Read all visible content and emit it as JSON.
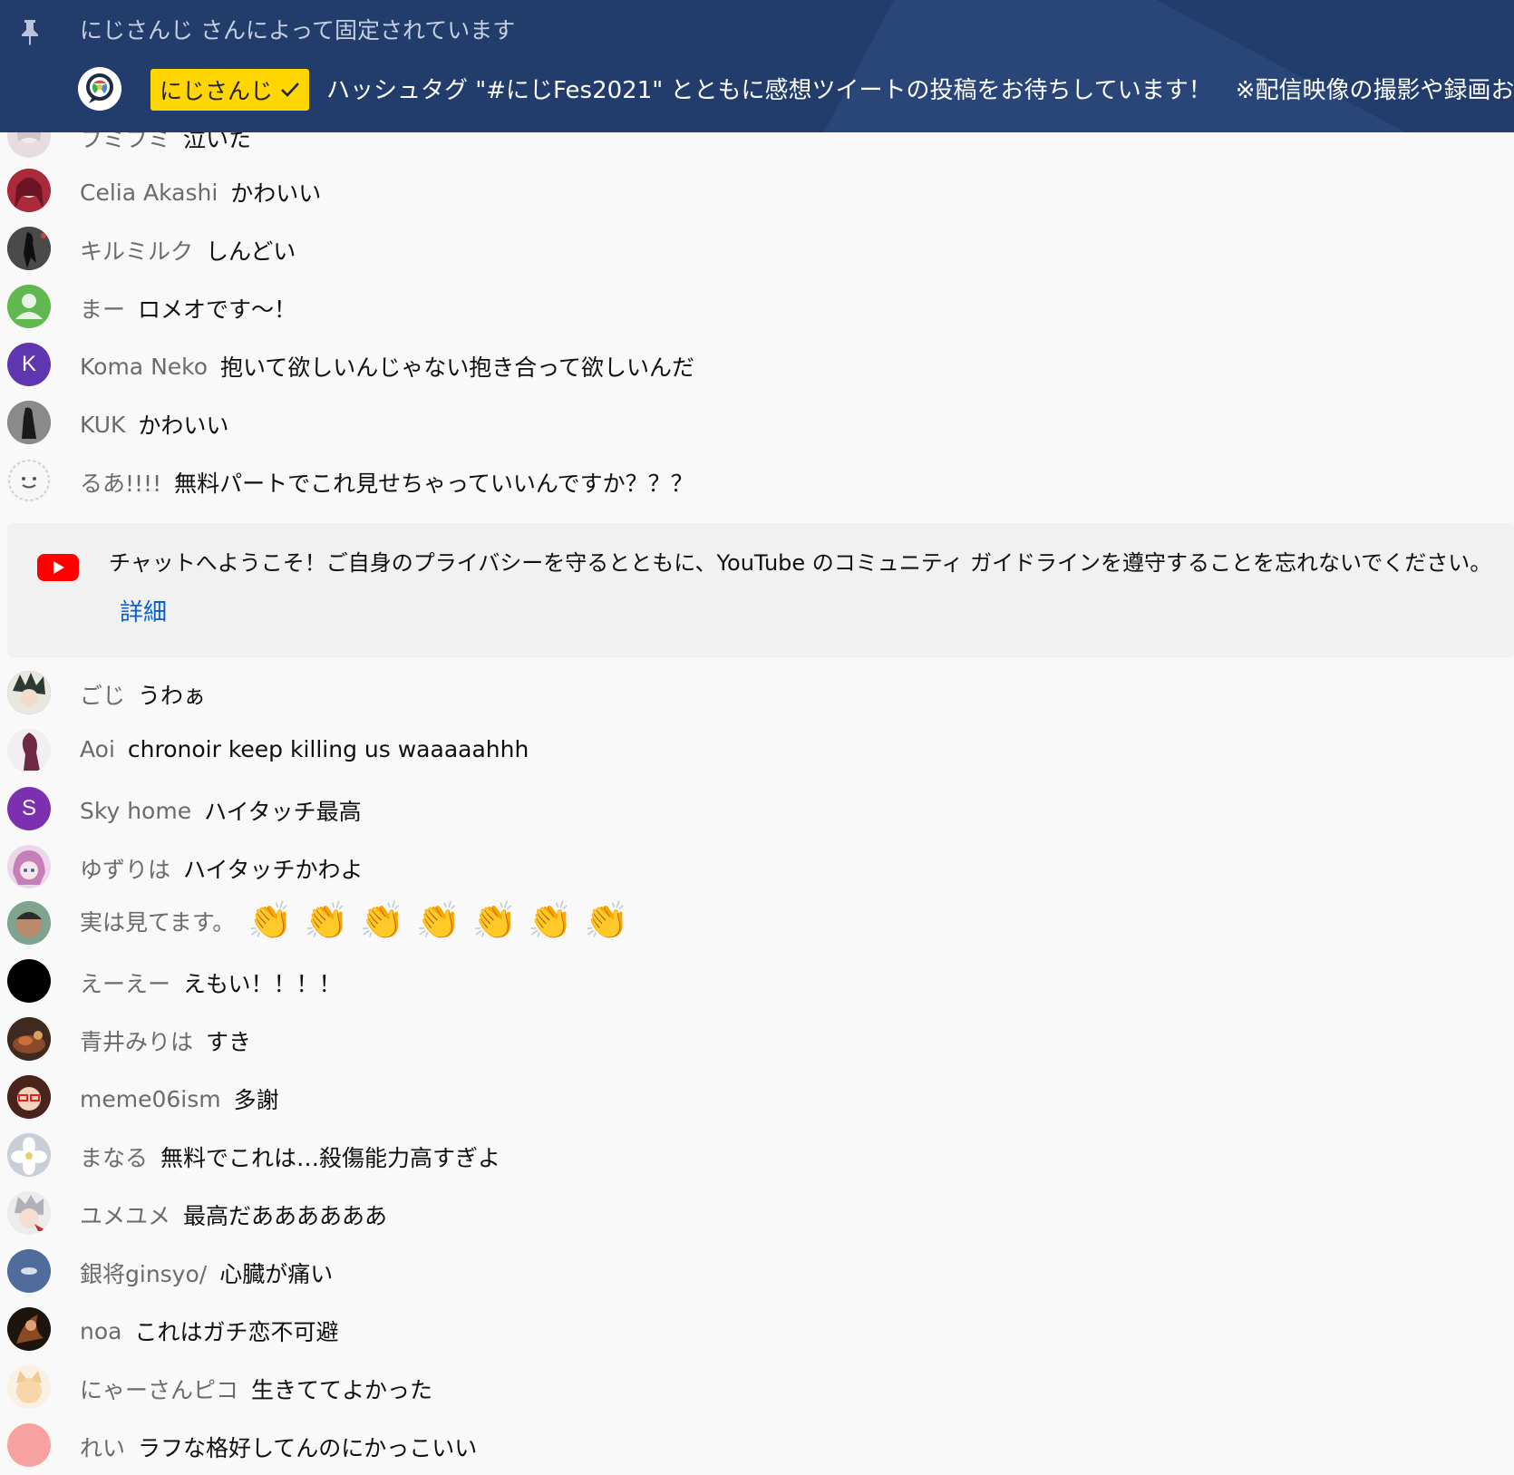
{
  "pinned": {
    "pinned_by": "にじさんじ さんによって固定されています",
    "author_badge": "にじさんじ",
    "message": "ハッシュタグ \"#にじFes2021\" とともに感想ツイートの投稿をお待ちしています！　※配信映像の撮影や録画およ"
  },
  "partial_message": {
    "author": "フミフミ",
    "text": "泣いた"
  },
  "messages_top": [
    {
      "author": "Celia Akashi",
      "text": "かわいい"
    },
    {
      "author": "キルミルク",
      "text": "しんどい"
    },
    {
      "author": "まー",
      "text": "ロメオです～！"
    },
    {
      "author": "Koma Neko",
      "text": "抱いて欲しいんじゃない抱き合って欲しいんだ",
      "avatar_letter": "K"
    },
    {
      "author": "KUK",
      "text": "かわいい"
    },
    {
      "author": "るあ!!!!",
      "text": "無料パートでこれ見せちゃっていいんですか？？？"
    }
  ],
  "welcome": {
    "text": "チャットへようこそ！ご自身のプライバシーを守るとともに、YouTube のコミュニティ ガイドラインを遵守することを忘れないでください。",
    "link": "詳細"
  },
  "messages_bottom": [
    {
      "author": "ごじ",
      "text": "うわぁ"
    },
    {
      "author": "Aoi",
      "text": "chronoir keep killing us waaaaahhh"
    },
    {
      "author": "Sky home",
      "text": "ハイタッチ最高",
      "avatar_letter": "S"
    },
    {
      "author": "ゆずりは",
      "text": "ハイタッチかわよ"
    },
    {
      "author": "実は見てます。",
      "text": "",
      "emoji": "👏"
    },
    {
      "author": "えーえー",
      "text": "えもい！！！！"
    },
    {
      "author": "青井みりは",
      "text": "すき"
    },
    {
      "author": "meme06ism",
      "text": "多謝"
    },
    {
      "author": "まなる",
      "text": "無料でこれは…殺傷能力高すぎよ"
    },
    {
      "author": "ユメユメ",
      "text": "最高だああああああ"
    },
    {
      "author": "銀将ginsyo/",
      "text": "心臓が痛い"
    },
    {
      "author": "noa",
      "text": "これはガチ恋不可避"
    },
    {
      "author": "にゃーさんピコ",
      "text": "生きててよかった"
    },
    {
      "author": "れい",
      "text": "ラフな格好してんのにかっこいい"
    }
  ],
  "colors": {
    "pinned_bg": "#223c6c",
    "badge_bg": "#ffd600",
    "link": "#065fd4",
    "author": "#6b6b6b",
    "youtube_red": "#ff0000"
  }
}
